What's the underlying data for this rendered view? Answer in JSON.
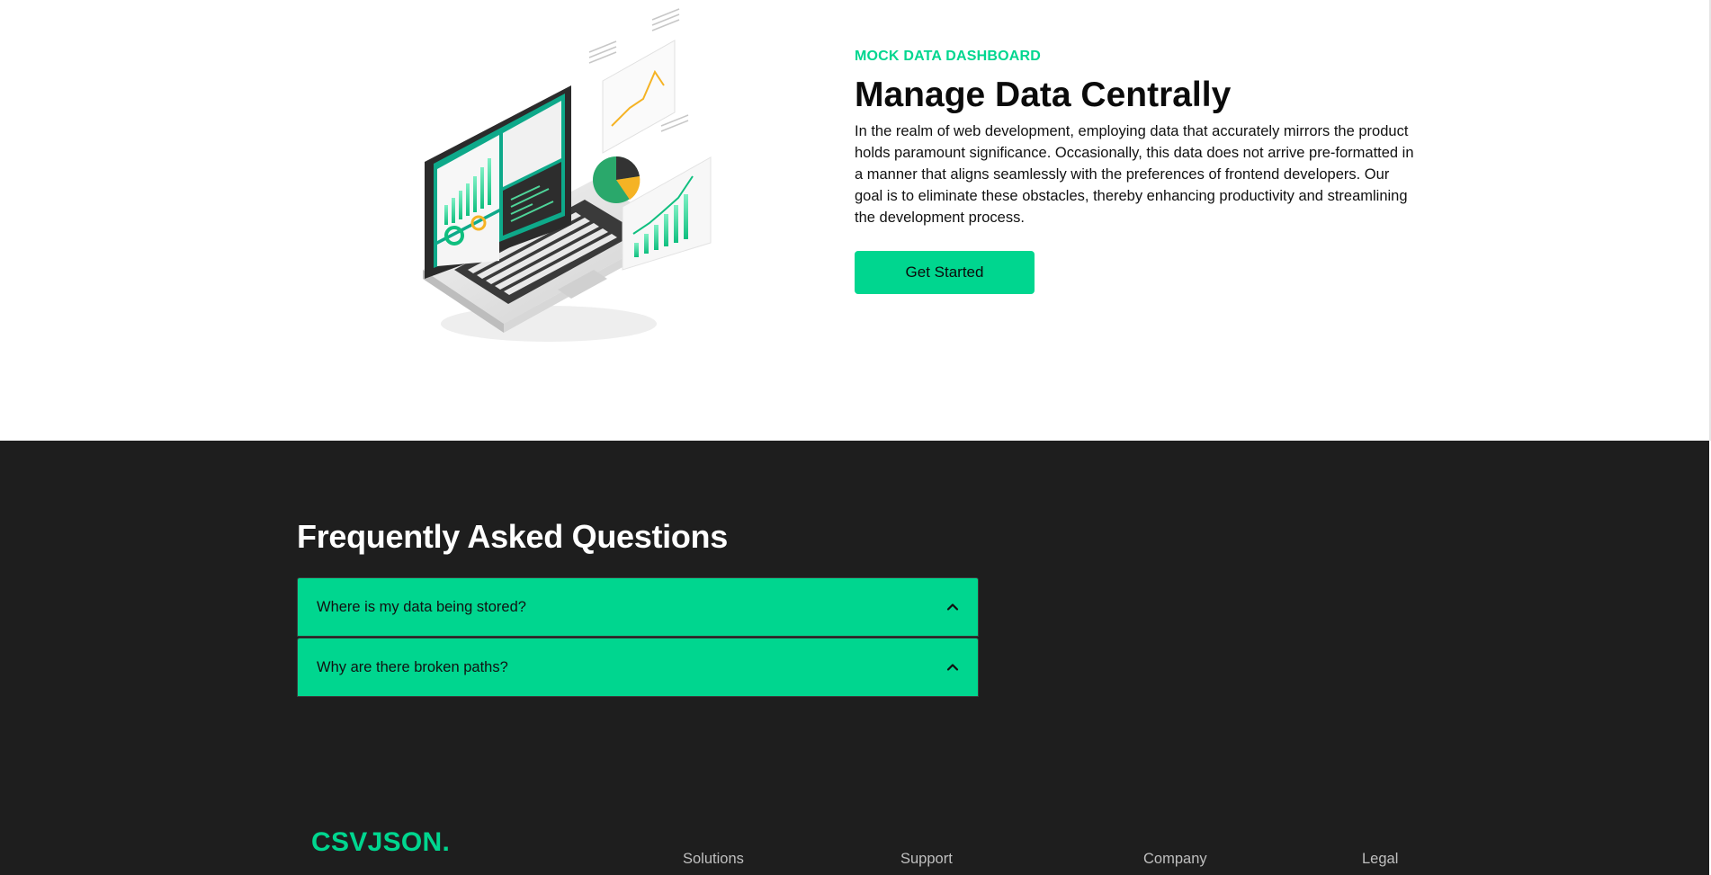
{
  "hero": {
    "eyebrow": "MOCK DATA DASHBOARD",
    "title": "Manage Data Centrally",
    "description": "In the realm of web development, employing data that accurately mirrors the product holds paramount significance. Occasionally, this data does not arrive pre-formatted in a manner that aligns seamlessly with the preferences of frontend developers. Our goal is to eliminate these obstacles, thereby enhancing productivity and streamlining the development process.",
    "cta_label": "Get Started",
    "illustration_icon": "laptop-dashboard-illustration"
  },
  "faq": {
    "title": "Frequently Asked Questions",
    "items": [
      {
        "question": "Where is my data being stored?",
        "icon": "chevron-up-icon"
      },
      {
        "question": "Why are there broken paths?",
        "icon": "chevron-up-icon"
      }
    ]
  },
  "footer": {
    "brand": "CSVJSON.",
    "nav": [
      "Solutions",
      "Support",
      "Company",
      "Legal"
    ]
  },
  "colors": {
    "accent": "#00d68f",
    "dark_bg": "#1e1e1e",
    "text": "#0b0b0b"
  }
}
